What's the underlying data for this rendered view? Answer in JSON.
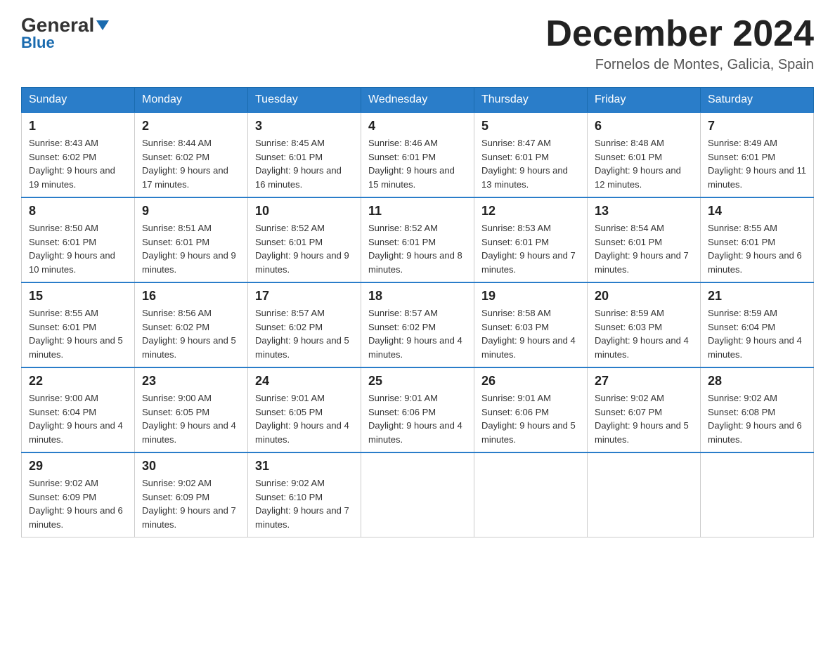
{
  "header": {
    "logo_general": "General",
    "logo_blue": "Blue",
    "month_title": "December 2024",
    "subtitle": "Fornelos de Montes, Galicia, Spain"
  },
  "days_of_week": [
    "Sunday",
    "Monday",
    "Tuesday",
    "Wednesday",
    "Thursday",
    "Friday",
    "Saturday"
  ],
  "weeks": [
    [
      {
        "day": "1",
        "sunrise": "8:43 AM",
        "sunset": "6:02 PM",
        "daylight": "9 hours and 19 minutes."
      },
      {
        "day": "2",
        "sunrise": "8:44 AM",
        "sunset": "6:02 PM",
        "daylight": "9 hours and 17 minutes."
      },
      {
        "day": "3",
        "sunrise": "8:45 AM",
        "sunset": "6:01 PM",
        "daylight": "9 hours and 16 minutes."
      },
      {
        "day": "4",
        "sunrise": "8:46 AM",
        "sunset": "6:01 PM",
        "daylight": "9 hours and 15 minutes."
      },
      {
        "day": "5",
        "sunrise": "8:47 AM",
        "sunset": "6:01 PM",
        "daylight": "9 hours and 13 minutes."
      },
      {
        "day": "6",
        "sunrise": "8:48 AM",
        "sunset": "6:01 PM",
        "daylight": "9 hours and 12 minutes."
      },
      {
        "day": "7",
        "sunrise": "8:49 AM",
        "sunset": "6:01 PM",
        "daylight": "9 hours and 11 minutes."
      }
    ],
    [
      {
        "day": "8",
        "sunrise": "8:50 AM",
        "sunset": "6:01 PM",
        "daylight": "9 hours and 10 minutes."
      },
      {
        "day": "9",
        "sunrise": "8:51 AM",
        "sunset": "6:01 PM",
        "daylight": "9 hours and 9 minutes."
      },
      {
        "day": "10",
        "sunrise": "8:52 AM",
        "sunset": "6:01 PM",
        "daylight": "9 hours and 9 minutes."
      },
      {
        "day": "11",
        "sunrise": "8:52 AM",
        "sunset": "6:01 PM",
        "daylight": "9 hours and 8 minutes."
      },
      {
        "day": "12",
        "sunrise": "8:53 AM",
        "sunset": "6:01 PM",
        "daylight": "9 hours and 7 minutes."
      },
      {
        "day": "13",
        "sunrise": "8:54 AM",
        "sunset": "6:01 PM",
        "daylight": "9 hours and 7 minutes."
      },
      {
        "day": "14",
        "sunrise": "8:55 AM",
        "sunset": "6:01 PM",
        "daylight": "9 hours and 6 minutes."
      }
    ],
    [
      {
        "day": "15",
        "sunrise": "8:55 AM",
        "sunset": "6:01 PM",
        "daylight": "9 hours and 5 minutes."
      },
      {
        "day": "16",
        "sunrise": "8:56 AM",
        "sunset": "6:02 PM",
        "daylight": "9 hours and 5 minutes."
      },
      {
        "day": "17",
        "sunrise": "8:57 AM",
        "sunset": "6:02 PM",
        "daylight": "9 hours and 5 minutes."
      },
      {
        "day": "18",
        "sunrise": "8:57 AM",
        "sunset": "6:02 PM",
        "daylight": "9 hours and 4 minutes."
      },
      {
        "day": "19",
        "sunrise": "8:58 AM",
        "sunset": "6:03 PM",
        "daylight": "9 hours and 4 minutes."
      },
      {
        "day": "20",
        "sunrise": "8:59 AM",
        "sunset": "6:03 PM",
        "daylight": "9 hours and 4 minutes."
      },
      {
        "day": "21",
        "sunrise": "8:59 AM",
        "sunset": "6:04 PM",
        "daylight": "9 hours and 4 minutes."
      }
    ],
    [
      {
        "day": "22",
        "sunrise": "9:00 AM",
        "sunset": "6:04 PM",
        "daylight": "9 hours and 4 minutes."
      },
      {
        "day": "23",
        "sunrise": "9:00 AM",
        "sunset": "6:05 PM",
        "daylight": "9 hours and 4 minutes."
      },
      {
        "day": "24",
        "sunrise": "9:01 AM",
        "sunset": "6:05 PM",
        "daylight": "9 hours and 4 minutes."
      },
      {
        "day": "25",
        "sunrise": "9:01 AM",
        "sunset": "6:06 PM",
        "daylight": "9 hours and 4 minutes."
      },
      {
        "day": "26",
        "sunrise": "9:01 AM",
        "sunset": "6:06 PM",
        "daylight": "9 hours and 5 minutes."
      },
      {
        "day": "27",
        "sunrise": "9:02 AM",
        "sunset": "6:07 PM",
        "daylight": "9 hours and 5 minutes."
      },
      {
        "day": "28",
        "sunrise": "9:02 AM",
        "sunset": "6:08 PM",
        "daylight": "9 hours and 6 minutes."
      }
    ],
    [
      {
        "day": "29",
        "sunrise": "9:02 AM",
        "sunset": "6:09 PM",
        "daylight": "9 hours and 6 minutes."
      },
      {
        "day": "30",
        "sunrise": "9:02 AM",
        "sunset": "6:09 PM",
        "daylight": "9 hours and 7 minutes."
      },
      {
        "day": "31",
        "sunrise": "9:02 AM",
        "sunset": "6:10 PM",
        "daylight": "9 hours and 7 minutes."
      },
      null,
      null,
      null,
      null
    ]
  ]
}
